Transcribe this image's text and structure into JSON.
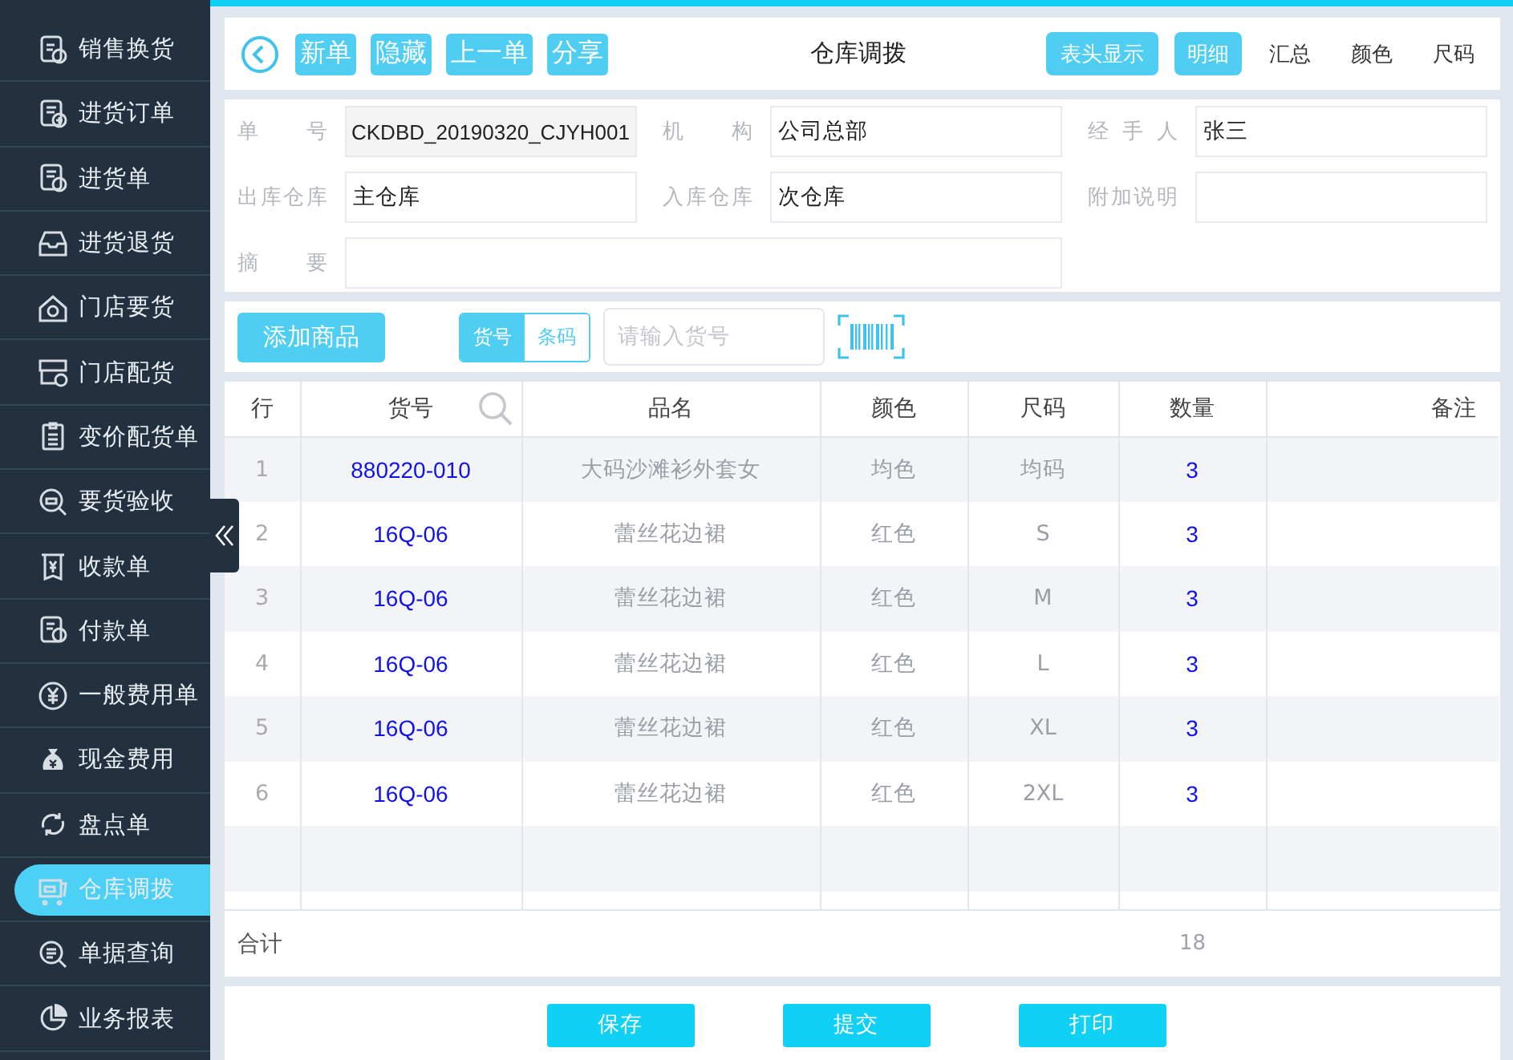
{
  "sidebar": {
    "items": [
      {
        "label": "销售换货",
        "selected": false
      },
      {
        "label": "进货订单",
        "selected": false
      },
      {
        "label": "进货单",
        "selected": false
      },
      {
        "label": "进货退货",
        "selected": false
      },
      {
        "label": "门店要货",
        "selected": false
      },
      {
        "label": "门店配货",
        "selected": false
      },
      {
        "label": "变价配货单",
        "selected": false
      },
      {
        "label": "要货验收",
        "selected": false
      },
      {
        "label": "收款单",
        "selected": false
      },
      {
        "label": "付款单",
        "selected": false
      },
      {
        "label": "一般费用单",
        "selected": false
      },
      {
        "label": "现金费用",
        "selected": false
      },
      {
        "label": "盘点单",
        "selected": false
      },
      {
        "label": "仓库调拨",
        "selected": true
      },
      {
        "label": "单据查询",
        "selected": false
      },
      {
        "label": "业务报表",
        "selected": false
      }
    ]
  },
  "toolbar": {
    "buttons": [
      "新单",
      "隐藏",
      "上一单",
      "分享"
    ],
    "title": "仓库调拨",
    "header_button": "表头显示",
    "views": [
      {
        "label": "明细",
        "selected": true
      },
      {
        "label": "汇总",
        "selected": false
      },
      {
        "label": "颜色",
        "selected": false
      },
      {
        "label": "尺码",
        "selected": false
      }
    ]
  },
  "form": {
    "fields": [
      {
        "label": "单号",
        "value": "CKDBD_20190320_CJYH001",
        "readonly": true
      },
      {
        "label": "机构",
        "value": "公司总部"
      },
      {
        "label": "经手人",
        "value": "张三"
      },
      {
        "label": "出库仓库",
        "value": "主仓库"
      },
      {
        "label": "入库仓库",
        "value": "次仓库"
      },
      {
        "label": "附加说明"
      },
      {
        "label": "摘要",
        "wide": true
      }
    ]
  },
  "search": {
    "add_button": "添加商品",
    "modes": [
      {
        "label": "货号",
        "selected": true
      },
      {
        "label": "条码",
        "selected": false
      }
    ],
    "placeholder": "请输入货号"
  },
  "table": {
    "columns": [
      "行",
      "货号",
      "品名",
      "颜色",
      "尺码",
      "数量",
      "备注"
    ],
    "rows": [
      [
        "1",
        "880220-010",
        "大码沙滩衫外套女",
        "均色",
        "均码",
        "3"
      ],
      [
        "2",
        "16Q-06",
        "蕾丝花边裙",
        "红色",
        "S",
        "3"
      ],
      [
        "3",
        "16Q-06",
        "蕾丝花边裙",
        "红色",
        "M",
        "3"
      ],
      [
        "4",
        "16Q-06",
        "蕾丝花边裙",
        "红色",
        "L",
        "3"
      ],
      [
        "5",
        "16Q-06",
        "蕾丝花边裙",
        "红色",
        "XL",
        "3"
      ],
      [
        "6",
        "16Q-06",
        "蕾丝花边裙",
        "红色",
        "2XL",
        "3"
      ]
    ],
    "total": {
      "label": "合计",
      "quantity": "18"
    }
  },
  "footer": {
    "buttons": [
      "保存",
      "提交",
      "打印"
    ]
  }
}
